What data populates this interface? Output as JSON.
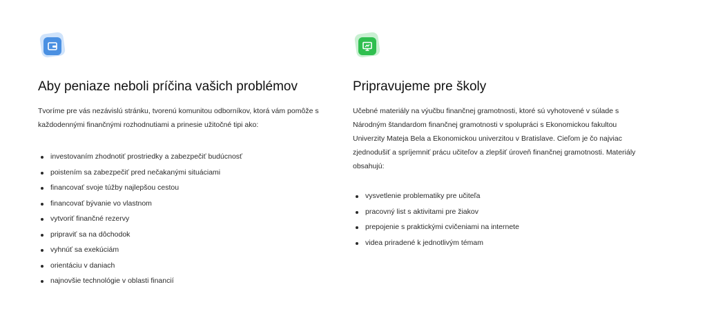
{
  "left": {
    "icon": "wallet-icon",
    "accent": "#4a90e2",
    "title": "Aby peniaze neboli príčina vašich problémov",
    "intro": "Tvoríme pre vás nezávislú stránku, tvorenú komunitou odborníkov, ktorá vám pomôže s každodennými finančnými rozhodnutiami a prinesie užitočné tipi ako:",
    "items": [
      "investovaním zhodnotiť prostriedky a zabezpečiť budúcnosť",
      "poistením sa zabezpečiť pred nečakanými situáciami",
      "financovať svoje túžby najlepšou cestou",
      "financovať bývanie vo vlastnom",
      "vytvoriť finančné rezervy",
      "pripraviť sa na dôchodok",
      "vyhnúť sa exekúciám",
      "orientáciu v daniach",
      "najnovšie technológie v oblasti financií"
    ]
  },
  "right": {
    "icon": "presentation-board-icon",
    "accent": "#2fbf4f",
    "title": "Pripravujeme pre školy",
    "intro": "Učebné materiály na výučbu finančnej gramotnosti, ktoré sú vyhotovené v súlade s Národným štandardom finančnej gramotnosti v spolupráci s Ekonomickou fakultou Univerzity Mateja Bela a Ekonomickou univerzitou v Bratislave. Cieľom je čo najviac zjednodušiť a spríjemniť prácu učiteľov a zlepšiť úroveň finančnej gramotnosti. Materiály obsahujú:",
    "items": [
      "vysvetlenie problematiky pre učiteľa",
      "pracovný list s aktivitami pre žiakov",
      "prepojenie s praktickými cvičeniami na internete",
      "videa priradené k jednotlivým témam"
    ]
  }
}
